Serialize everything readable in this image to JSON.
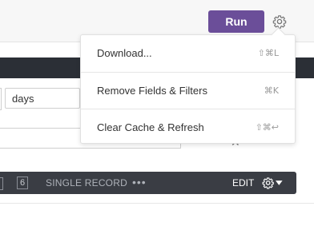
{
  "toolbar": {
    "run_label": "Run",
    "settings_icon": "gear-icon"
  },
  "filters": {
    "period_unit_value": "days"
  },
  "results_bar": {
    "count": "6",
    "view_mode": "SINGLE RECORD",
    "more": "•••",
    "edit_label": "EDIT",
    "settings_icon": "gear-icon"
  },
  "menu": {
    "items": [
      {
        "label": "Download...",
        "shortcut": "⇧⌘L"
      },
      {
        "label": "Remove Fields & Filters",
        "shortcut": "⌘K"
      },
      {
        "label": "Clear Cache & Refresh",
        "shortcut": "⇧⌘↩"
      }
    ]
  },
  "colors": {
    "run_button": "#6b4e99",
    "results_bar": "#3a3d44",
    "dark_header": "#2b2f36"
  }
}
